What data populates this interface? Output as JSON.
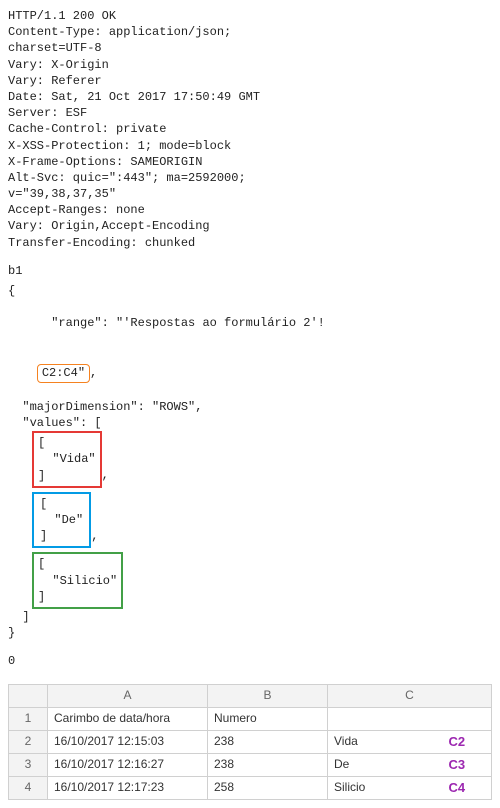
{
  "http": {
    "status_line": "HTTP/1.1 200 OK",
    "headers": [
      "Content-Type: application/json;",
      "charset=UTF-8",
      "Vary: X-Origin",
      "Vary: Referer",
      "Date: Sat, 21 Oct 2017 17:50:49 GMT",
      "Server: ESF",
      "Cache-Control: private",
      "X-XSS-Protection: 1; mode=block",
      "X-Frame-Options: SAMEORIGIN",
      "Alt-Svc: quic=\":443\"; ma=2592000;",
      "v=\"39,38,37,35\"",
      "Accept-Ranges: none",
      "Vary: Origin,Accept-Encoding",
      "Transfer-Encoding: chunked"
    ]
  },
  "chunk_marker": "b1",
  "json": {
    "range_key_part": "  \"range\": \"'Respostas ao formulário 2'!",
    "range_cells": "C2:C4\"",
    "after_range": ",",
    "major_line": "  \"majorDimension\": \"ROWS\",",
    "values_open": "  \"values\": [",
    "row1_open": "[",
    "row1_value": "  \"Vida\"",
    "row1_close": "]",
    "row1_comma": ",",
    "row2_open": "[",
    "row2_value": "  \"De\"",
    "row2_close": "]",
    "row2_comma": ",",
    "row3_open": "[",
    "row3_value": "  \"Silicio\"",
    "row3_close": "]",
    "values_close": "  ]",
    "obj_close": "}"
  },
  "trailing_zero": "0",
  "sheet": {
    "cols": {
      "a": "A",
      "b": "B",
      "c": "C"
    },
    "header_row_idx": "1",
    "headers": {
      "a": "Carimbo de data/hora",
      "b": "Numero",
      "c": ""
    },
    "rows": [
      {
        "idx": "2",
        "a": "16/10/2017 12:15:03",
        "b": "238",
        "c": "Vida",
        "label": "C2"
      },
      {
        "idx": "3",
        "a": "16/10/2017 12:16:27",
        "b": "238",
        "c": "De",
        "label": "C3"
      },
      {
        "idx": "4",
        "a": "16/10/2017 12:17:23",
        "b": "258",
        "c": "Silicio",
        "label": "C4"
      }
    ]
  }
}
